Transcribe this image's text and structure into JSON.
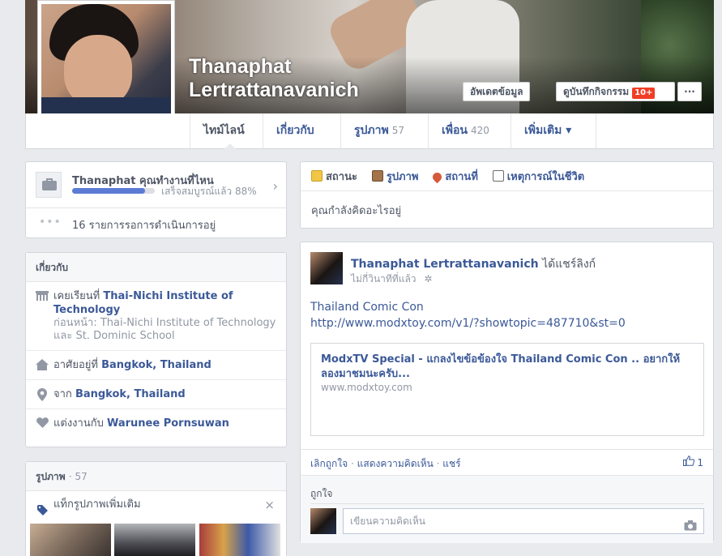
{
  "profile": {
    "first_name": "Thanaphat",
    "last_name": "Lertrattanavanich",
    "camera_icon": "camera-icon"
  },
  "cover_buttons": {
    "update_info": "อัพเดตข้อมูล",
    "activity_log": "ดูบันทึกกิจกรรม",
    "activity_badge": "10+",
    "more": "···"
  },
  "nav_tabs": [
    {
      "label": "ไทม์ไลน์",
      "count": ""
    },
    {
      "label": "เกี่ยวกับ",
      "count": ""
    },
    {
      "label": "รูปภาพ",
      "count": "57"
    },
    {
      "label": "เพื่อน",
      "count": "420"
    },
    {
      "label": "เพิ่มเติม ▾",
      "count": ""
    }
  ],
  "work_prompt": {
    "title": "Thanaphat คุณทำงานที่ไหน",
    "progress_text": "เสร็จสมบูรณ์แล้ว 88%",
    "progress": 0.88,
    "pending": "16 รายการรอการดำเนินการอยู่"
  },
  "about": {
    "header": "เกี่ยวกับ",
    "studied_prefix": "เคยเรียนที่",
    "studied_at": "Thai-Nichi Institute of Technology",
    "previously": "ก่อนหน้า: Thai-Nichi Institute of Technology และ St. Dominic School",
    "lives_prefix": "อาศัยอยู่ที่",
    "lives_in": "Bangkok, Thailand",
    "from_prefix": "จาก",
    "from": "Bangkok, Thailand",
    "married_prefix": "แต่งงานกับ",
    "married_to": "Warunee Pornsuwan"
  },
  "photos": {
    "header": "รูปภาพ",
    "count": "· 57",
    "tag_more": "แท็กรูปภาพเพิ่มเติม",
    "close": "×"
  },
  "composer": {
    "tabs": [
      "สถานะ",
      "รูปภาพ",
      "สถานที่",
      "เหตุการณ์ในชีวิต"
    ],
    "placeholder": "คุณกำลังคิดอะไรอยู่"
  },
  "post": {
    "author": "Thanaphat Lertrattanavanich",
    "action": "ได้แชร์ลิงก์",
    "time": "ไม่กี่วินาทีที่แล้ว",
    "text_line1": "Thailand Comic Con",
    "url": "http://www.modxtoy.com/v1/?showtopic=487710&st=0",
    "link_title": "ModxTV Special - แกลงไขข้อข้องใจ Thailand Comic Con .. อยากให้ลองมาชมนะครับ...",
    "link_domain": "www.modxtoy.com",
    "actions": [
      "เลิกถูกใจ",
      "แสดงความคิดเห็น",
      "แชร์"
    ],
    "separator": "·",
    "like_count": "1",
    "likes_label": "ถูกใจ",
    "comment_placeholder": "เขียนความคิดเห็น"
  },
  "colors": {
    "link": "#3b5998",
    "background": "#e9eaed",
    "progress": "#5b7bd5",
    "badge": "#f03d25"
  }
}
